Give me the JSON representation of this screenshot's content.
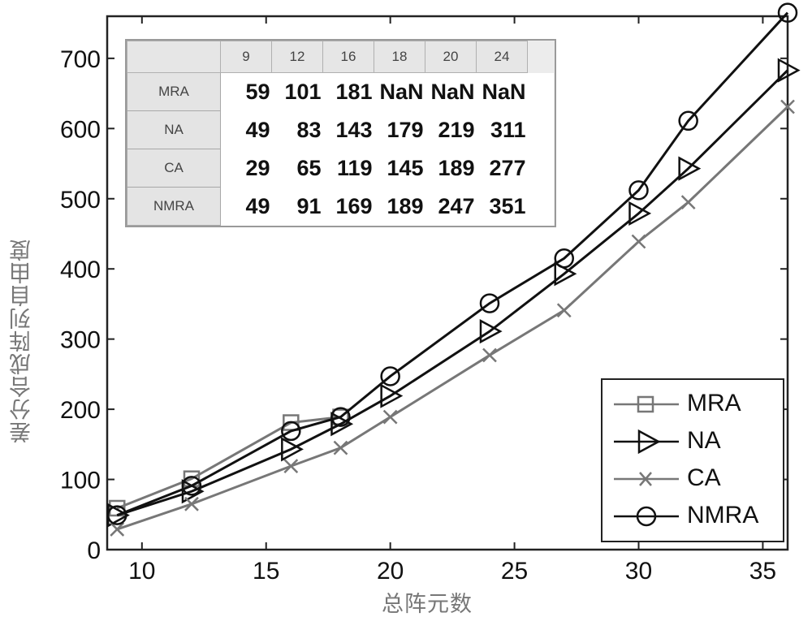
{
  "chart_data": {
    "type": "line",
    "title": "",
    "xlabel": "总阵元数",
    "ylabel": "差分合成阵列自由度",
    "xlim": [
      8.6,
      36
    ],
    "ylim": [
      0,
      760
    ],
    "xticks": [
      10,
      15,
      20,
      25,
      30,
      35
    ],
    "yticks": [
      0,
      100,
      200,
      300,
      400,
      500,
      600,
      700
    ],
    "grid": false,
    "legend_position": "bottom-right",
    "series": [
      {
        "name": "MRA",
        "marker": "square",
        "color": "#777777",
        "x": [
          9,
          12,
          16,
          18
        ],
        "y": [
          59,
          101,
          181,
          189
        ]
      },
      {
        "name": "NA",
        "marker": "triangle-right",
        "color": "#111111",
        "x": [
          9,
          12,
          16,
          18,
          20,
          24,
          27,
          30,
          32,
          36
        ],
        "y": [
          49,
          83,
          143,
          179,
          219,
          311,
          393,
          479,
          543,
          683
        ]
      },
      {
        "name": "CA",
        "marker": "x",
        "color": "#777777",
        "x": [
          9,
          12,
          16,
          18,
          20,
          24,
          27,
          30,
          32,
          36
        ],
        "y": [
          29,
          65,
          119,
          145,
          189,
          277,
          341,
          439,
          495,
          631
        ]
      },
      {
        "name": "NMRA",
        "marker": "circle",
        "color": "#111111",
        "x": [
          9,
          12,
          16,
          18,
          20,
          24,
          27,
          30,
          32,
          36
        ],
        "y": [
          49,
          91,
          169,
          189,
          247,
          351,
          415,
          512,
          611,
          765
        ]
      }
    ],
    "inset_table": {
      "columns": [
        "9",
        "12",
        "16",
        "18",
        "20",
        "24"
      ],
      "rows": [
        {
          "label": "MRA",
          "values": [
            "59",
            "101",
            "181",
            "NaN",
            "NaN",
            "NaN"
          ]
        },
        {
          "label": "NA",
          "values": [
            "49",
            "83",
            "143",
            "179",
            "219",
            "311"
          ]
        },
        {
          "label": "CA",
          "values": [
            "29",
            "65",
            "119",
            "145",
            "189",
            "277"
          ]
        },
        {
          "label": "NMRA",
          "values": [
            "49",
            "91",
            "169",
            "189",
            "247",
            "351"
          ]
        }
      ]
    }
  }
}
